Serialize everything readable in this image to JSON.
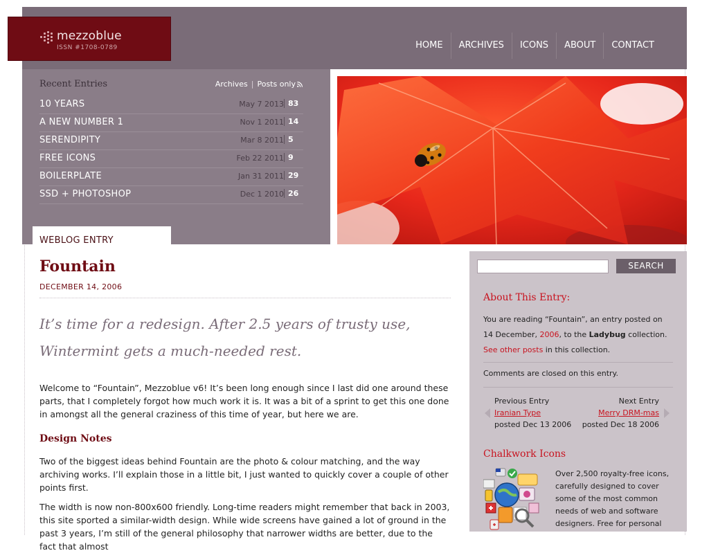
{
  "site": {
    "logo_name": "mezzoblue",
    "issn": "ISSN #1708-0789"
  },
  "nav": [
    "HOME",
    "ARCHIVES",
    "ICONS",
    "ABOUT",
    "CONTACT"
  ],
  "recent": {
    "title": "Recent Entries",
    "archives_link": "Archives",
    "separator": "|",
    "posts_only_link": "Posts only",
    "entries": [
      {
        "title": "10 YEARS",
        "date": "May 7 2013",
        "count": "83"
      },
      {
        "title": "A NEW NUMBER 1",
        "date": "Nov 1 2011",
        "count": "14"
      },
      {
        "title": "SERENDIPITY",
        "date": "Mar 8 2011",
        "count": "5"
      },
      {
        "title": "FREE ICONS",
        "date": "Feb 22 2011",
        "count": "9"
      },
      {
        "title": "BOILERPLATE",
        "date": "Jan 31 2011",
        "count": "29"
      },
      {
        "title": "SSD + PHOTOSHOP",
        "date": "Dec 1 2010",
        "count": "26"
      }
    ]
  },
  "weblog_tab": "WEBLOG ENTRY",
  "post": {
    "title": "Fountain",
    "date": "DECEMBER 14, 2006",
    "lead_line1": "It’s time for a redesign. After 2.5 years of trusty use,",
    "lead_line2": "Wintermint gets a much-needed rest.",
    "para1": "Welcome to “Fountain”, Mezzoblue v6! It’s been long enough since I last did one around these parts, that I completely forgot how much work it is. It was a bit of a sprint to get this one done in amongst all the general craziness of this time of year, but here we are.",
    "design_notes": "Design Notes",
    "para2": "Two of the biggest ideas behind Fountain are the photo & colour matching, and the way archiving works. I’ll explain those in a little bit, I just wanted to quickly cover a couple of other points first.",
    "para3": "The width is now non-800x600 friendly. Long-time readers might remember that back in 2003, this site sported a similar-width design. While wide screens have gained a lot of ground in the past 3 years, I’m still of the general philosophy that narrower widths are better, due to the fact that almost"
  },
  "sidebar": {
    "search_button": "SEARCH",
    "about_heading": "About This Entry:",
    "about_1": "You are reading “Fountain”, an entry posted on 14 December, ",
    "about_year": "2006",
    "about_2": ", to the ",
    "about_collection": "Ladybug",
    "about_3": " collection. ",
    "about_see": "See other posts",
    "about_4": " in this collection.",
    "comments_closed": "Comments are closed on this entry.",
    "prev_label": "Previous Entry",
    "prev_title": "Iranian Type",
    "prev_posted": "posted Dec 13 2006",
    "next_label": "Next Entry",
    "next_title": "Merry DRM-mas",
    "next_posted": "posted Dec 18 2006",
    "chalk_heading": "Chalkwork Icons",
    "chalk_text": "Over 2,500 royalty-free icons, carefully designed to cover some of the most common needs of web and software designers. Free for personal"
  },
  "colors": {
    "topbar": "#7a6c78",
    "panel": "#8a7d88",
    "logo_bg": "#6f0c14",
    "accent_red": "#c8131f",
    "sidebar_bg": "#cbc3c9"
  }
}
